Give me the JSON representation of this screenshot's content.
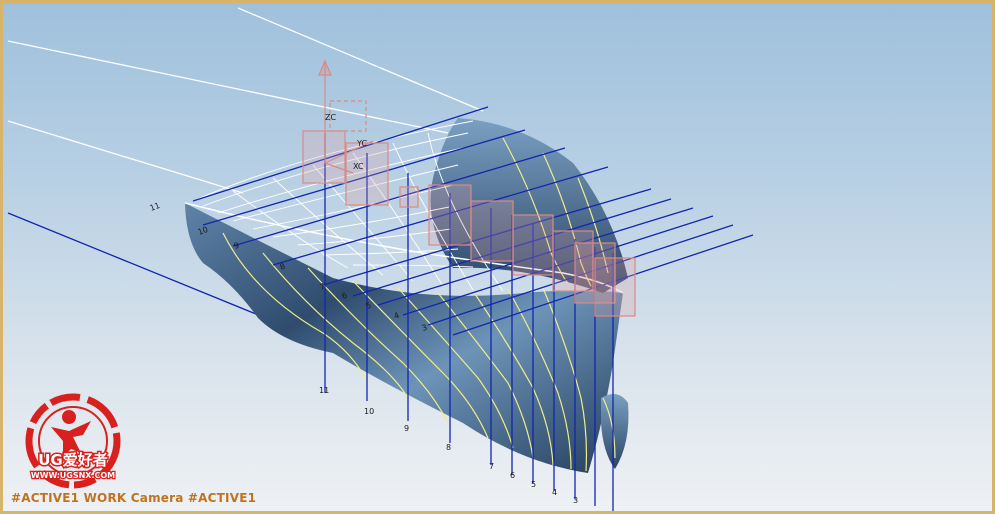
{
  "viewport": {
    "status_text": "#ACTIVE1 WORK Camera #ACTIVE1",
    "axis_labels": {
      "zc": "ZC",
      "yc": "YC",
      "xc": "XC"
    },
    "station_labels": [
      "11",
      "10",
      "9",
      "8",
      "7",
      "6",
      "5",
      "4",
      "3"
    ],
    "top_labels": [
      "11",
      "10",
      "9",
      "8",
      "7",
      "6",
      "5",
      "4",
      "3"
    ]
  },
  "watermark": {
    "brand_text": "UG爱好者",
    "url_text": "WWW.UGSNX.COM"
  },
  "colors": {
    "hull_dark": "#2e4a6b",
    "hull_light": "#8fb2cf",
    "station_line": "#1226b0",
    "section_curve": "#f0ec8a",
    "datum_plane": "#d98a85",
    "status_text": "#c0731f",
    "logo_red": "#d8211e"
  }
}
